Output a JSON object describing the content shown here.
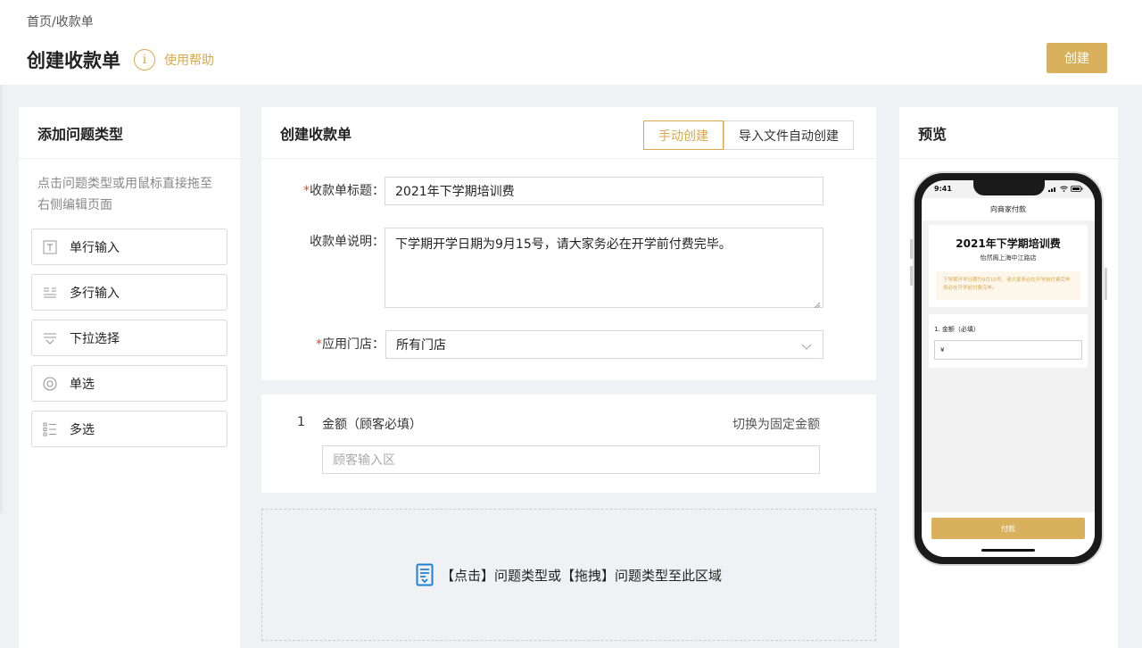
{
  "header": {
    "breadcrumb": "首页/收款单",
    "title": "创建收款单",
    "help_label": "使用帮助",
    "create_label": "创建"
  },
  "left_panel": {
    "title": "添加问题类型",
    "hint": "点击问题类型或用鼠标直接拖至右侧编辑页面",
    "types": [
      {
        "label": "单行输入",
        "icon": "text-input-icon"
      },
      {
        "label": "多行输入",
        "icon": "multiline-icon"
      },
      {
        "label": "下拉选择",
        "icon": "dropdown-icon"
      },
      {
        "label": "单选",
        "icon": "radio-icon"
      },
      {
        "label": "多选",
        "icon": "checkbox-list-icon"
      }
    ]
  },
  "form": {
    "title": "创建收款单",
    "tabs": [
      {
        "label": "手动创建",
        "active": true
      },
      {
        "label": "导入文件自动创建",
        "active": false
      }
    ],
    "title_field": {
      "required_mark": "*",
      "label": "收款单标题：",
      "value": "2021年下学期培训费"
    },
    "desc_field": {
      "label": "收款单说明：",
      "value": "下学期开学日期为9月15号，请大家务必在开学前付费完毕。"
    },
    "store_field": {
      "required_mark": "*",
      "label": "应用门店：",
      "value": "所有门店"
    }
  },
  "amount_card": {
    "index": "1",
    "title": "金额（顾客必填）",
    "switch_label": "切换为固定金额",
    "placeholder": "顾客输入区"
  },
  "dropzone": {
    "text": "【点击】问题类型或【拖拽】问题类型至此区域"
  },
  "preview": {
    "title": "预览",
    "time": "9:41",
    "nav_title": "向商家付款",
    "order_title": "2021年下学期培训费",
    "store": "怡然阁上海中江路店",
    "desc": "下学期开学日期为9月15号，请大家务必在开学前付费完毕务必在开学前付费完毕。",
    "amount_label": "1. 金额（必填）",
    "amount_prefix": "¥",
    "pay_label": "付款"
  },
  "colors": {
    "accent": "#d9a84e",
    "button": "#d9b05c",
    "required": "#e04a2a",
    "page_bg": "#f0f1f5"
  }
}
